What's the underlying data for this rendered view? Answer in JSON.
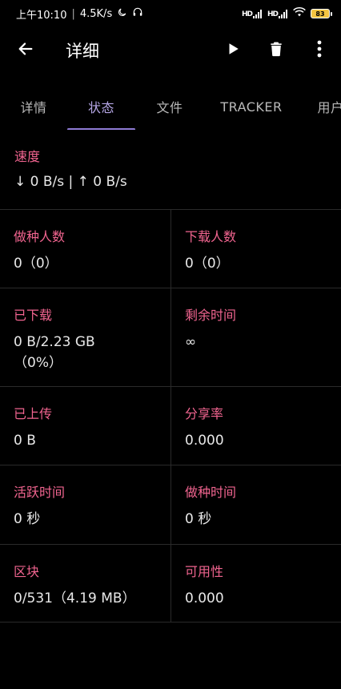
{
  "status_bar": {
    "time": "上午10:10",
    "net_speed": "4.5K/s",
    "separator": "|",
    "moon_icon": "moon-icon",
    "headset_icon": "headset-icon",
    "signal1_label": "HD",
    "signal2_label": "HD",
    "battery_level": "83"
  },
  "appbar": {
    "title": "详细",
    "back_icon": "arrow-left-icon",
    "play_icon": "play-icon",
    "delete_icon": "trash-icon",
    "more_icon": "more-vert-icon"
  },
  "tabs": {
    "items": [
      {
        "label": "详情"
      },
      {
        "label": "状态"
      },
      {
        "label": "文件"
      },
      {
        "label": "TRACKER"
      },
      {
        "label": "用户"
      }
    ],
    "active_index": 1
  },
  "speed": {
    "label": "速度",
    "value": "↓ 0 B/s | ↑ 0 B/s"
  },
  "stats": {
    "rows": [
      [
        {
          "label": "做种人数",
          "value": "0（0）"
        },
        {
          "label": "下载人数",
          "value": "0（0）"
        }
      ],
      [
        {
          "label": "已下载",
          "value": "0 B/2.23 GB\n（0%）"
        },
        {
          "label": "剩余时间",
          "value": "∞"
        }
      ],
      [
        {
          "label": "已上传",
          "value": "0 B"
        },
        {
          "label": "分享率",
          "value": "0.000"
        }
      ],
      [
        {
          "label": "活跃时间",
          "value": "0 秒"
        },
        {
          "label": "做种时间",
          "value": "0 秒"
        }
      ],
      [
        {
          "label": "区块",
          "value": "0/531（4.19 MB）"
        },
        {
          "label": "可用性",
          "value": "0.000"
        }
      ]
    ]
  },
  "colors": {
    "background": "#000000",
    "label": "#f0648f",
    "accent": "#8e7bd4",
    "active_tab": "#b6a7e6"
  }
}
